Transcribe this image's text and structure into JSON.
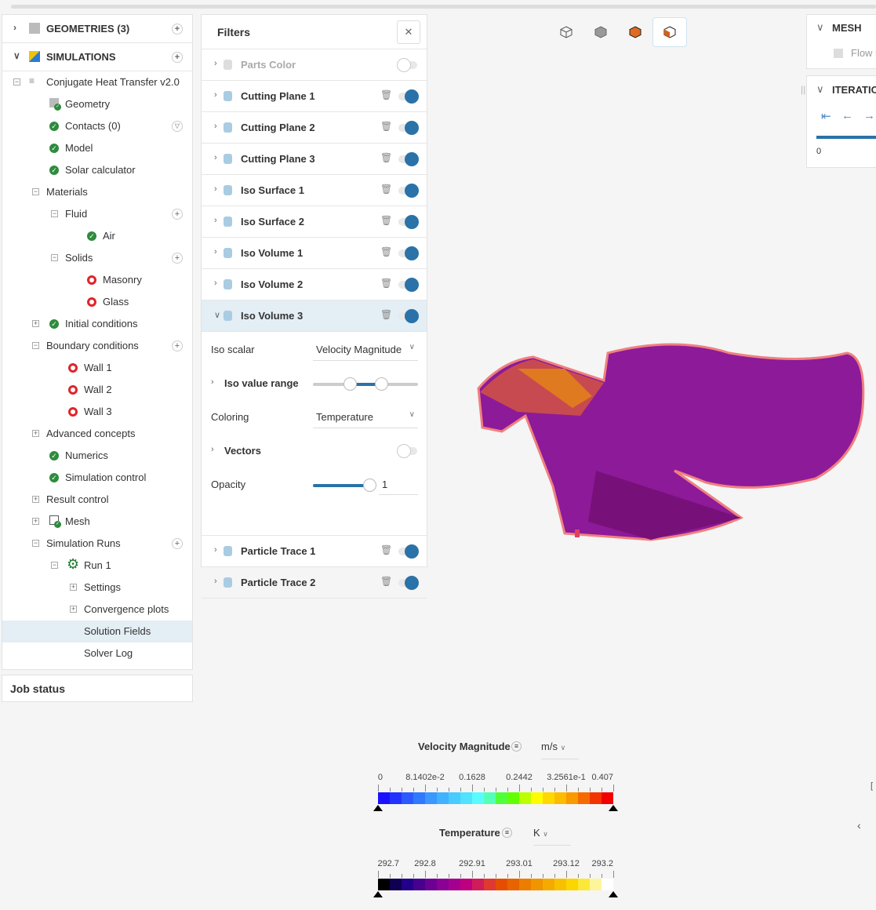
{
  "tree": {
    "geometries": "GEOMETRIES (3)",
    "simulations": "SIMULATIONS",
    "rows": [
      "Conjugate Heat Transfer v2.0",
      "Geometry",
      "Contacts (0)",
      "Model",
      "Solar calculator",
      "Materials",
      "Fluid",
      "Air",
      "Solids",
      "Masonry",
      "Glass",
      "Initial conditions",
      "Boundary conditions",
      "Wall 1",
      "Wall 2",
      "Wall 3",
      "Advanced concepts",
      "Numerics",
      "Simulation control",
      "Result control",
      "Mesh",
      "Simulation Runs",
      "Run 1",
      "Settings",
      "Convergence plots",
      "Solution Fields",
      "Solver Log"
    ],
    "selected": "Solution Fields"
  },
  "job_status": "Job status",
  "filters": {
    "title": "Filters",
    "close_icon": "close-icon",
    "items": [
      {
        "name": "Parts Color",
        "enabled": false,
        "disabled": true
      },
      {
        "name": "Cutting Plane 1",
        "enabled": true
      },
      {
        "name": "Cutting Plane 2",
        "enabled": true
      },
      {
        "name": "Cutting Plane 3",
        "enabled": true
      },
      {
        "name": "Iso Surface 1",
        "enabled": true
      },
      {
        "name": "Iso Surface 2",
        "enabled": true
      },
      {
        "name": "Iso Volume 1",
        "enabled": true
      },
      {
        "name": "Iso Volume 2",
        "enabled": true
      },
      {
        "name": "Iso Volume 3",
        "enabled": true,
        "expanded": true
      },
      {
        "name": "Particle Trace 1",
        "enabled": true
      },
      {
        "name": "Particle Trace 2",
        "enabled": true
      }
    ],
    "detail": {
      "iso_scalar_label": "Iso scalar",
      "iso_scalar": "Velocity Magnitude",
      "iso_range_label": "Iso value range",
      "iso_range_fraction": [
        0.35,
        0.65
      ],
      "coloring_label": "Coloring",
      "coloring": "Temperature",
      "vectors_label": "Vectors",
      "vectors_enabled": false,
      "opacity_label": "Opacity",
      "opacity": "1"
    }
  },
  "right": {
    "mesh": "MESH",
    "mesh_item": "Flow r",
    "iterations": "ITERATIO",
    "iteration_value": "0"
  },
  "legends": [
    {
      "title": "Velocity Magnitude",
      "unit": "m/s",
      "ticks": [
        "0",
        "8.1402e-2",
        "0.1628",
        "0.2442",
        "3.2561e-1",
        "0.407"
      ],
      "colors": [
        "#1a12ff",
        "#2233ff",
        "#2a5aff",
        "#2f78ff",
        "#3a98ff",
        "#40b2ff",
        "#48cbff",
        "#50e2ff",
        "#58fcff",
        "#55ffb8",
        "#50ff3a",
        "#62ff00",
        "#bcff00",
        "#fffc00",
        "#ffd800",
        "#fcbc00",
        "#f99a00",
        "#f66b00",
        "#f23400",
        "#f20000"
      ]
    },
    {
      "title": "Temperature",
      "unit": "K",
      "ticks": [
        "292.7",
        "292.8",
        "292.91",
        "293.01",
        "293.12",
        "293.2"
      ],
      "colors": [
        "#000000",
        "#0f0051",
        "#22008a",
        "#48008e",
        "#6c0092",
        "#8b0095",
        "#a4008f",
        "#bd0080",
        "#d01d5a",
        "#de3a31",
        "#e54e00",
        "#e86400",
        "#ec7d00",
        "#f09400",
        "#f5aa00",
        "#f8c100",
        "#fbd600",
        "#fde83a",
        "#fdf59a",
        "#ffffff"
      ]
    }
  ]
}
